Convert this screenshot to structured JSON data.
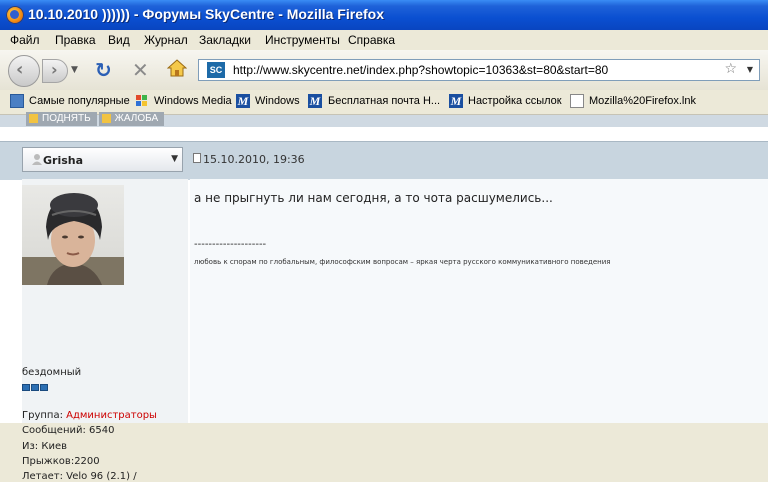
{
  "window": {
    "title": "10.10.2010 )))))) - Форумы SkyCentre - Mozilla Firefox"
  },
  "menu": [
    "Файл",
    "Правка",
    "Вид",
    "Журнал",
    "Закладки",
    "Инструменты",
    "Справка"
  ],
  "toolbar": {
    "url": "http://www.skycentre.net/index.php?showtopic=10363&st=80&start=80",
    "site_icon_text": "SC"
  },
  "bookmarks": [
    "Самые популярные",
    "Windows Media",
    "Windows",
    "Бесплатная почта Н...",
    "Настройка ссылок",
    "Mozilla%20Firefox.lnk"
  ],
  "post_buttons": {
    "raise": "ПОДНЯТЬ",
    "complain": "ЖАЛОБА"
  },
  "post": {
    "author": "Grisha",
    "date": "15.10.2010, 19:36",
    "message": "а не прыгнуть ли нам сегодня, а то чота расшумелись...",
    "signature_separator": "--------------------",
    "signature": "любовь к спорам по глобальным, философским вопросам – яркая черта русского коммуникативного поведения"
  },
  "user_info": {
    "status": "бездомный",
    "rank_pips": 3,
    "group_label": "Группа: ",
    "group_value": "Администраторы",
    "messages": "Сообщений: 6540",
    "from": "Из: Киев",
    "jumps": "Прыжков:2200",
    "flies": "Летает: Velo 96 (2.1) /"
  },
  "colors": {
    "title_bar": "#0a4fd1",
    "group_admin": "#cc0000",
    "post_bar": "#c8d5df"
  }
}
